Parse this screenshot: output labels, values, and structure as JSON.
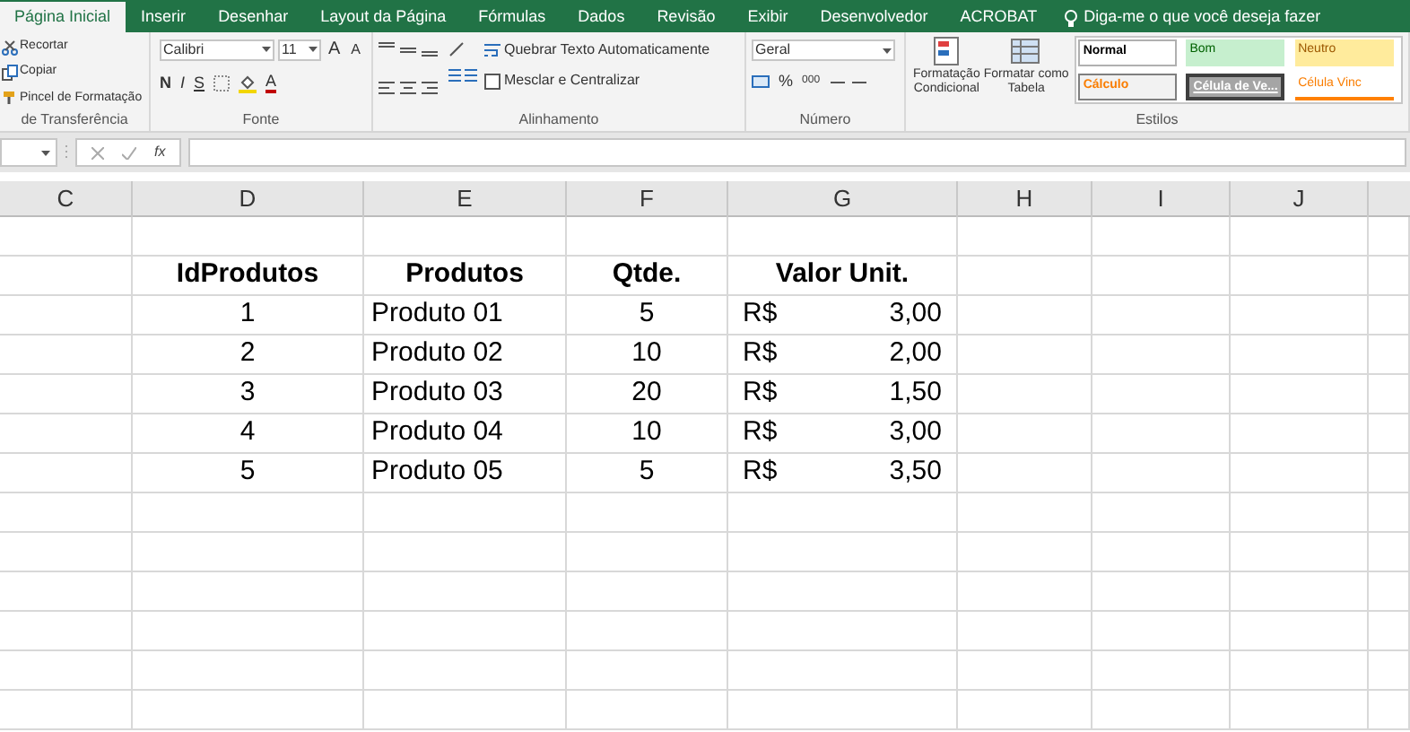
{
  "ribbon_tabs": [
    {
      "label": "Página Inicial",
      "selected": true
    },
    {
      "label": "Inserir",
      "selected": false
    },
    {
      "label": "Desenhar",
      "selected": false
    },
    {
      "label": "Layout da Página",
      "selected": false
    },
    {
      "label": "Fórmulas",
      "selected": false
    },
    {
      "label": "Dados",
      "selected": false
    },
    {
      "label": "Revisão",
      "selected": false
    },
    {
      "label": "Exibir",
      "selected": false
    },
    {
      "label": "Desenvolvedor",
      "selected": false
    },
    {
      "label": "ACROBAT",
      "selected": false
    }
  ],
  "tell_me": "Diga-me o que você deseja fazer",
  "clipboard": {
    "items": [
      "Recortar",
      "Copiar",
      "Pincel de Formatação"
    ],
    "label": "de Transferência"
  },
  "font": {
    "name": "Calibri",
    "size": "11",
    "grow": "A",
    "shrink": "A",
    "bold": "N",
    "italic": "I",
    "underline": "S",
    "color_letter": "A",
    "label": "Fonte"
  },
  "alignment": {
    "wrap": "Quebrar Texto Automaticamente",
    "merge": "Mesclar e Centralizar",
    "label": "Alinhamento"
  },
  "number": {
    "format": "Geral",
    "percent": "%",
    "thousands": "000",
    "label": "Número"
  },
  "styles": {
    "conditional": [
      "Formatação",
      "Condicional"
    ],
    "as_table": [
      "Formatar como",
      "Tabela"
    ],
    "cells": [
      {
        "label": "Normal",
        "kind": "normal"
      },
      {
        "label": "Bom",
        "kind": "good"
      },
      {
        "label": "Neutro",
        "kind": "neutral"
      },
      {
        "label": "Cálculo",
        "kind": "calc"
      },
      {
        "label": "Célula de Ve...",
        "kind": "check"
      },
      {
        "label": "Célula Vinc",
        "kind": "linked"
      }
    ],
    "label": "Estilos"
  },
  "formula_bar": {
    "fx": "fx"
  },
  "columns": [
    "C",
    "D",
    "E",
    "F",
    "G",
    "H",
    "I",
    "J"
  ],
  "table": {
    "header": [
      "IdProdutos",
      "Produtos",
      "Qtde.",
      "Valor Unit."
    ],
    "rows": [
      {
        "id": "1",
        "product": "Produto 01",
        "qty": "5",
        "currency": "R$",
        "value": "3,00"
      },
      {
        "id": "2",
        "product": "Produto 02",
        "qty": "10",
        "currency": "R$",
        "value": "2,00"
      },
      {
        "id": "3",
        "product": "Produto 03",
        "qty": "20",
        "currency": "R$",
        "value": "1,50"
      },
      {
        "id": "4",
        "product": "Produto 04",
        "qty": "10",
        "currency": "R$",
        "value": "3,00"
      },
      {
        "id": "5",
        "product": "Produto 05",
        "qty": "5",
        "currency": "R$",
        "value": "3,50"
      }
    ]
  }
}
